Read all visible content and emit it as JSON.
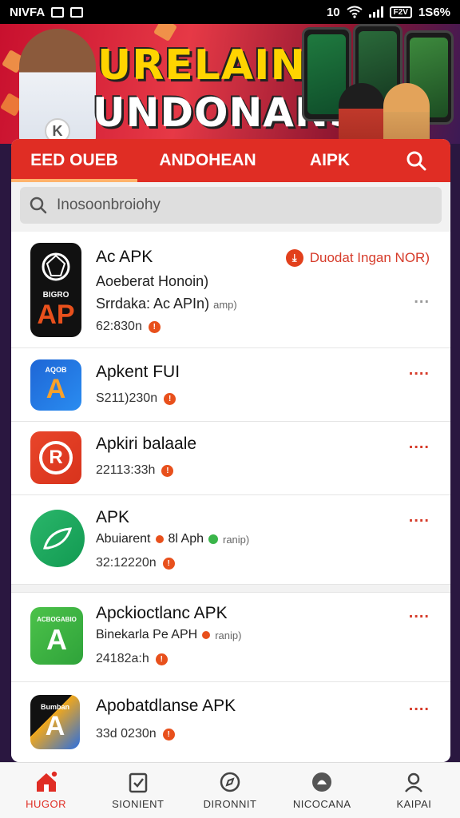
{
  "status_bar": {
    "carrier": "NIVFA",
    "time_left": "10",
    "battery": "F2V",
    "battery_text": "1S6%"
  },
  "banner": {
    "title_line1": "URELAINA",
    "title_line2": "UNDONANSIA",
    "badge": "K"
  },
  "tabs": [
    {
      "label": "EED OUEB",
      "active": true
    },
    {
      "label": "ANDOHEAN",
      "active": false
    },
    {
      "label": "AIPK",
      "active": false
    }
  ],
  "search": {
    "placeholder": "Inosoonbroiohy"
  },
  "apps": [
    {
      "name": "Ac APK",
      "subtitle": "Aoeberat Honoin)",
      "subtitle2": "Srrdaka: Ac APIn)",
      "subtitle2_small": "amp)",
      "meta": "62:830n",
      "icon_text_top": "BIGRO",
      "icon_text": "AP",
      "download_label": "Duodat Ingan NOR)",
      "more": "..."
    },
    {
      "name": "Apkent FUI",
      "meta": "S211)230n",
      "icon_text_top": "AQOB",
      "icon_text": "A",
      "more": "...."
    },
    {
      "name": "Apkiri balaale",
      "meta": "22113:33h",
      "icon_text": "R",
      "more": "...."
    },
    {
      "name": "APK",
      "subtitle": "Abuiarent",
      "subtitle_mid": "8l Aph",
      "subtitle_small": "ranip)",
      "meta": "32:12220n",
      "icon_text": "",
      "more": "...."
    },
    {
      "name": "Apckioctlanc APK",
      "subtitle": "Binekarla Pe APH",
      "subtitle_small": "ranip)",
      "meta": "24182a:h",
      "icon_text_top": "ACBOGABIO",
      "icon_text": "A",
      "more": "...."
    },
    {
      "name": "Apobatdlanse APK",
      "meta": "33d 0230n",
      "icon_text_top": "Bumban",
      "icon_text": "A",
      "more": "...."
    }
  ],
  "bottom_nav": [
    {
      "label": "HUGOR",
      "icon": "home-icon",
      "active": true
    },
    {
      "label": "SIONIENT",
      "icon": "clipboard-check-icon",
      "active": false
    },
    {
      "label": "DIRONNIT",
      "icon": "compass-icon",
      "active": false
    },
    {
      "label": "NICOCANA",
      "icon": "android-icon",
      "active": false
    },
    {
      "label": "KAIPAI",
      "icon": "user-icon",
      "active": false
    }
  ],
  "colors": {
    "primary": "#e02d24",
    "accent": "#d63b2a",
    "tab_indicator": "#ffb36b"
  }
}
